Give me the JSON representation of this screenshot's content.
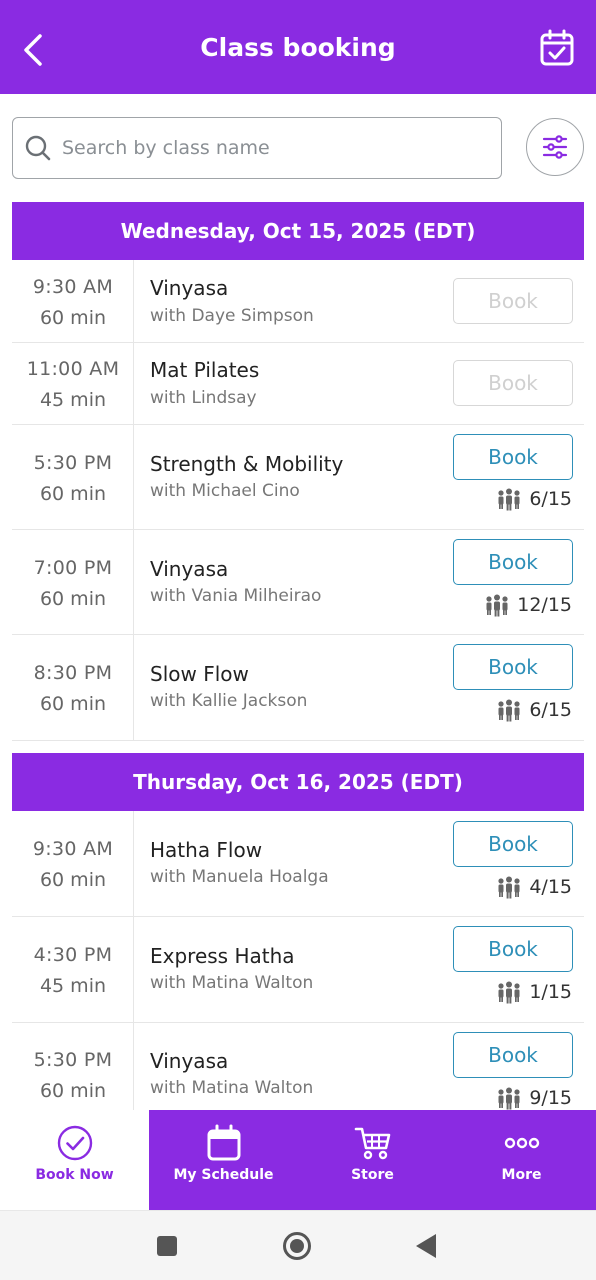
{
  "header": {
    "title": "Class booking"
  },
  "search": {
    "placeholder": "Search by class name"
  },
  "days": [
    {
      "label": "Wednesday, Oct 15, 2025 (EDT)",
      "classes": [
        {
          "time": "9:30  AM",
          "duration": "60 min",
          "name": "Vinyasa",
          "instructor": "with Daye Simpson",
          "book_label": "Book",
          "enabled": false,
          "capacity": ""
        },
        {
          "time": "11:00  AM",
          "duration": "45 min",
          "name": "Mat Pilates",
          "instructor": "with Lindsay",
          "book_label": "Book",
          "enabled": false,
          "capacity": ""
        },
        {
          "time": "5:30  PM",
          "duration": "60 min",
          "name": "Strength & Mobility",
          "instructor": "with Michael Cino",
          "book_label": "Book",
          "enabled": true,
          "capacity": "6/15"
        },
        {
          "time": "7:00  PM",
          "duration": "60 min",
          "name": "Vinyasa",
          "instructor": "with Vania Milheirao",
          "book_label": "Book",
          "enabled": true,
          "capacity": "12/15"
        },
        {
          "time": "8:30  PM",
          "duration": "60 min",
          "name": "Slow Flow",
          "instructor": "with Kallie Jackson",
          "book_label": "Book",
          "enabled": true,
          "capacity": "6/15"
        }
      ]
    },
    {
      "label": "Thursday, Oct 16, 2025 (EDT)",
      "classes": [
        {
          "time": "9:30  AM",
          "duration": "60 min",
          "name": "Hatha Flow",
          "instructor": "with Manuela Hoalga",
          "book_label": "Book",
          "enabled": true,
          "capacity": "4/15"
        },
        {
          "time": "4:30  PM",
          "duration": "45 min",
          "name": "Express Hatha",
          "instructor": "with Matina Walton",
          "book_label": "Book",
          "enabled": true,
          "capacity": "1/15"
        },
        {
          "time": "5:30  PM",
          "duration": "60 min",
          "name": "Vinyasa",
          "instructor": "with Matina Walton",
          "book_label": "Book",
          "enabled": true,
          "capacity": "9/15"
        }
      ]
    }
  ],
  "tabs": [
    {
      "label": "Book Now",
      "icon": "check-circle-icon",
      "active": true
    },
    {
      "label": "My Schedule",
      "icon": "calendar-icon",
      "active": false
    },
    {
      "label": "Store",
      "icon": "cart-icon",
      "active": false
    },
    {
      "label": "More",
      "icon": "more-dots-icon",
      "active": false
    }
  ],
  "colors": {
    "brand": "#8a2be2",
    "book_button": "#2e8fb8",
    "disabled": "#d0d0d0"
  }
}
